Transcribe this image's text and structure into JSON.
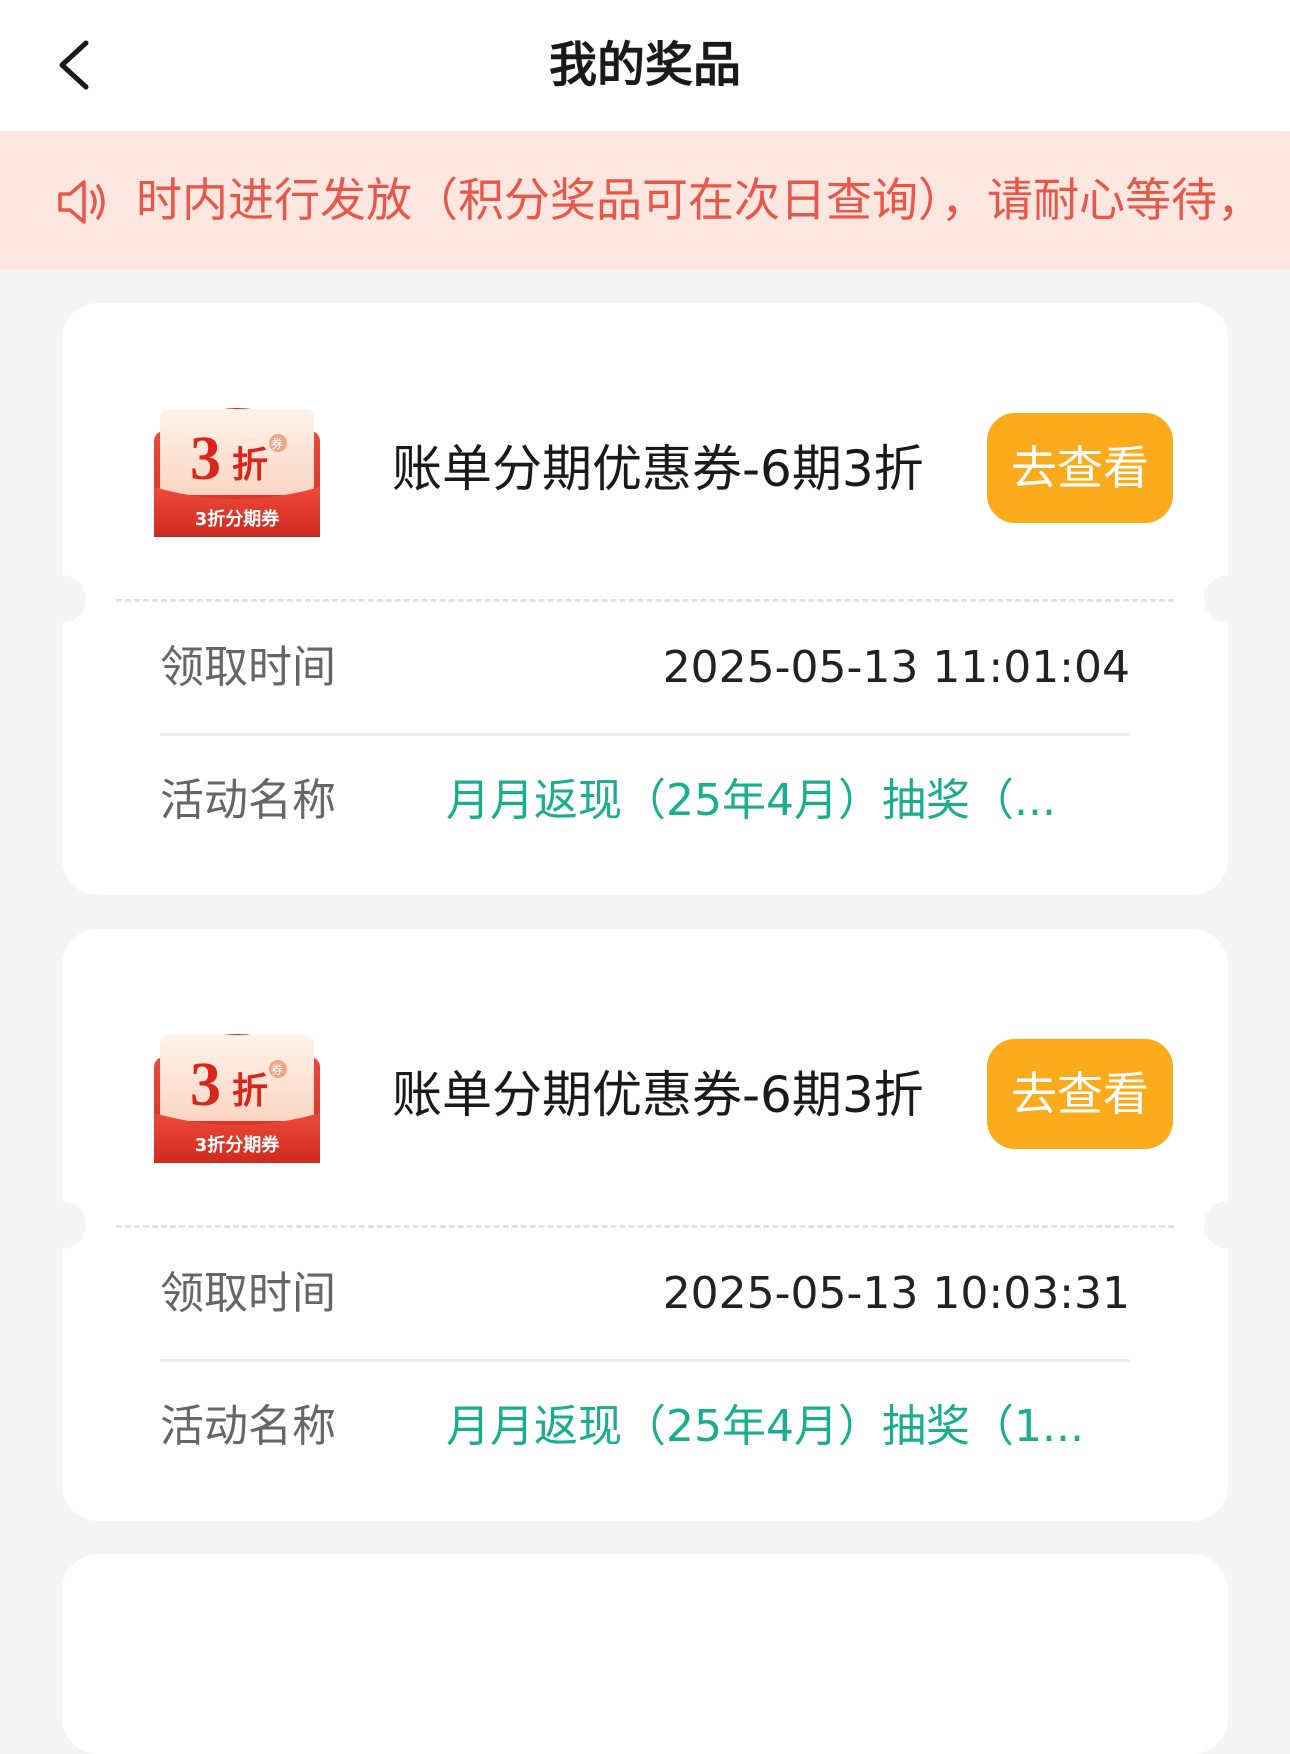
{
  "header": {
    "title": "我的奖品"
  },
  "notice": {
    "text": "时内进行发放（积分奖品可在次日查询），请耐心等待，"
  },
  "labels": {
    "receive_time": "领取时间",
    "activity_name": "活动名称",
    "view_button": "去查看"
  },
  "coupon_badge": {
    "big_number": "3",
    "big_unit": "折",
    "tag": "券",
    "caption": "3折分期券"
  },
  "prizes": [
    {
      "name": "账单分期优惠券-6期3折",
      "receive_time": "2025-05-13 11:01:04",
      "activity": "月月返现（25年4月）抽奖（..."
    },
    {
      "name": "账单分期优惠券-6期3折",
      "receive_time": "2025-05-13 10:03:31",
      "activity": "月月返现（25年4月）抽奖（1..."
    }
  ],
  "colors": {
    "accent_orange": "#fbab1c",
    "notice_red": "#e8574a",
    "activity_green": "#1aae8f",
    "coupon_red": "#e23a2e"
  }
}
